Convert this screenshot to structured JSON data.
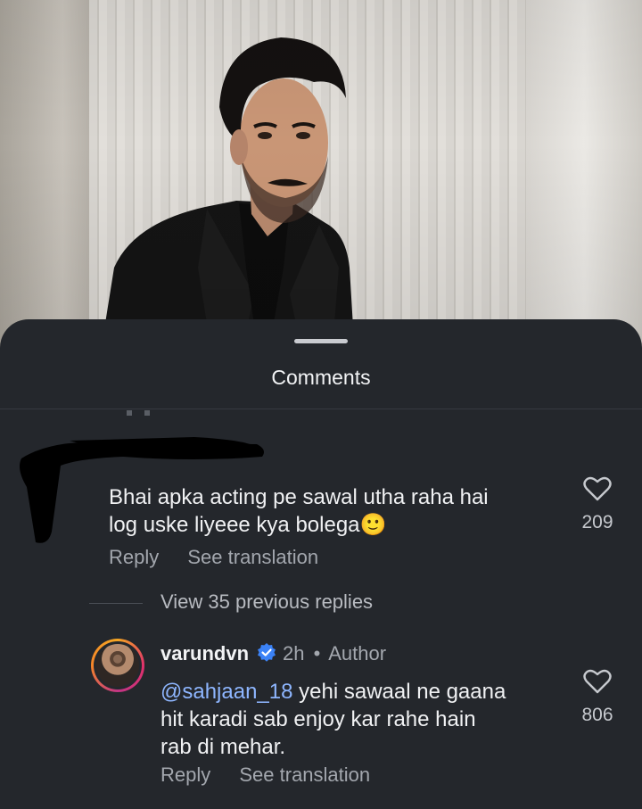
{
  "sheet": {
    "title": "Comments"
  },
  "comment_1": {
    "text": "Bhai apka acting pe sawal utha raha hai\nlog uske liyeee kya bolega",
    "emoji": "🙂",
    "likes": "209",
    "reply_label": "Reply",
    "translate_label": "See translation"
  },
  "replies_link": "View 35 previous replies",
  "comment_2": {
    "username": "varundvn",
    "time": "2h",
    "separator": "•",
    "badge": "Author",
    "mention": "@sahjaan_18",
    "text": " yehi sawaal ne gaana\nhit karadi sab enjoy kar rahe hain\nrab di mehar.",
    "likes": "806",
    "reply_label": "Reply",
    "translate_label": "See translation"
  },
  "icons": {
    "like": "heart-outline-icon",
    "verified": "verified-badge-icon"
  },
  "colors": {
    "sheet_bg": "#24272c",
    "mention": "#8eb6ff",
    "verified": "#3b82f6"
  }
}
